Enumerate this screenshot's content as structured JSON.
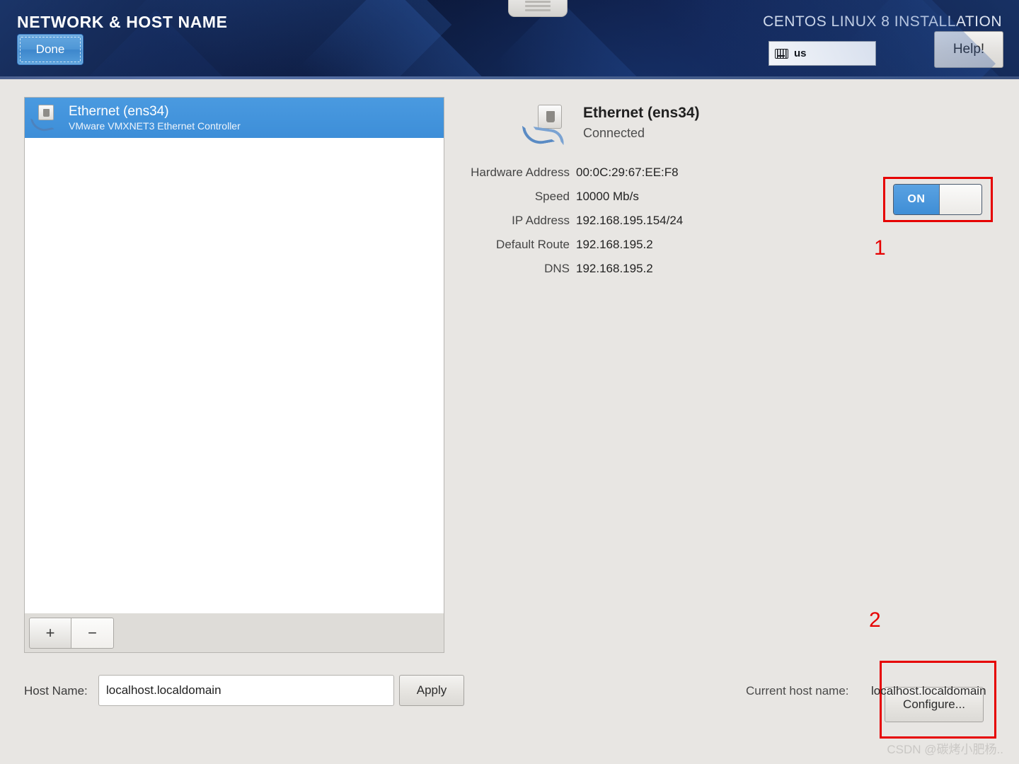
{
  "header": {
    "page_title": "NETWORK & HOST NAME",
    "done_label": "Done",
    "install_label": "CENTOS LINUX 8 INSTALLATION",
    "keyboard_layout": "us",
    "keyboard_icon": "keyboard-icon",
    "help_label": "Help!",
    "grip_icon": "window-grip-icon"
  },
  "device_list": {
    "items": [
      {
        "name": "Ethernet (ens34)",
        "description": "VMware VMXNET3 Ethernet Controller",
        "icon": "ethernet-icon",
        "selected": true
      }
    ],
    "toolbar": {
      "add_label": "+",
      "remove_label": "−"
    }
  },
  "detail": {
    "icon": "ethernet-icon",
    "title": "Ethernet (ens34)",
    "status": "Connected",
    "fields": [
      {
        "label": "Hardware Address",
        "value": "00:0C:29:67:EE:F8"
      },
      {
        "label": "Speed",
        "value": "10000 Mb/s"
      },
      {
        "label": "IP Address",
        "value": "192.168.195.154/24"
      },
      {
        "label": "Default Route",
        "value": "192.168.195.2"
      },
      {
        "label": "DNS",
        "value": "192.168.195.2"
      }
    ],
    "toggle": {
      "state_label": "ON",
      "state": "on"
    },
    "configure_label": "Configure..."
  },
  "annotations": [
    {
      "number": "1",
      "target": "on-toggle"
    },
    {
      "number": "2",
      "target": "configure-button"
    }
  ],
  "hostname": {
    "label": "Host Name:",
    "value": "localhost.localdomain",
    "placeholder": "localhost.localdomain",
    "apply_label": "Apply",
    "current_label": "Current host name:",
    "current_value": "localhost.localdomain"
  },
  "watermark": "CSDN @碳烤小肥杨..",
  "colors": {
    "accent_blue": "#3d8ed8",
    "annotation_red": "#e60000",
    "header_dark": "#0b1738",
    "panel_gray": "#e8e6e3"
  }
}
